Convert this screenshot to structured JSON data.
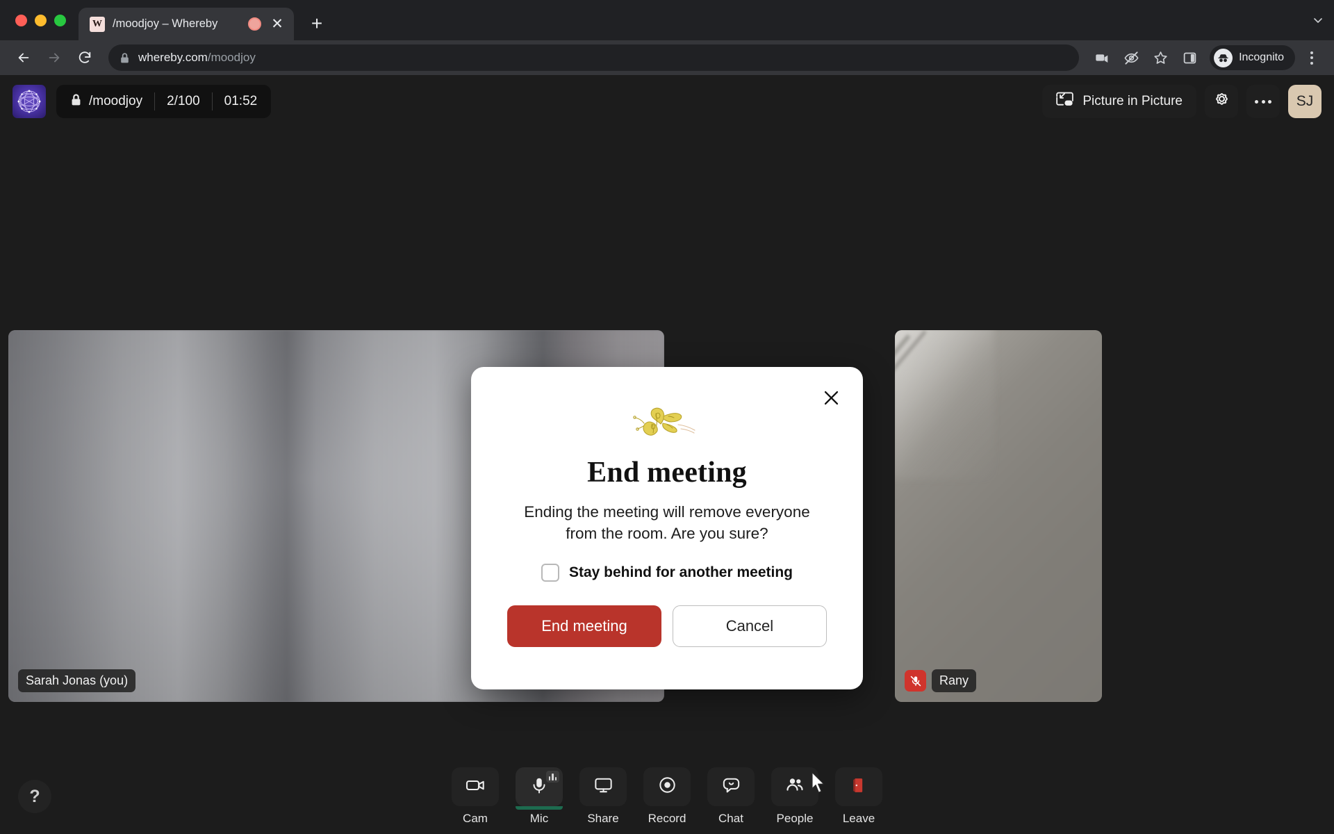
{
  "browser": {
    "tab": {
      "favicon_letter": "W",
      "title": "/moodjoy – Whereby",
      "media_indicator_icon": "recording-indicator-icon",
      "close_icon": "✕"
    },
    "new_tab_icon": "+",
    "tabstrip_chevron_icon": "⌄",
    "nav": {
      "back_icon": "back-arrow-icon",
      "forward_icon": "forward-arrow-icon",
      "reload_icon": "reload-icon"
    },
    "omnibox": {
      "lock_icon": "lock-icon",
      "url_domain": "whereby.com",
      "url_path": "/moodjoy"
    },
    "toolbar_icons": [
      "camera-icon",
      "eye-off-icon",
      "star-icon",
      "side-panel-icon"
    ],
    "profile": {
      "label": "Incognito",
      "avatar_icon": "incognito-hat-icon"
    },
    "menu_icon": "three-dot-menu-icon"
  },
  "app_header": {
    "logo_icon": "whereby-room-logo",
    "room": {
      "lock_icon": "lock-icon",
      "room_name": "/moodjoy",
      "participants": "2/100",
      "elapsed": "01:52"
    },
    "pip": {
      "icon": "picture-in-picture-icon",
      "label": "Picture in Picture"
    },
    "settings_icon": "gear-icon",
    "more_icon": "three-dot-menu-icon",
    "avatar_initials": "SJ"
  },
  "tiles": [
    {
      "name": "Sarah Jonas (you)",
      "muted": false,
      "mute_icon": "mic-off-icon"
    },
    {
      "name": "Rany",
      "muted": true,
      "mute_icon": "mic-off-icon"
    }
  ],
  "bottom_toolbar": [
    {
      "label": "Cam",
      "icon": "camera-icon",
      "active": false
    },
    {
      "label": "Mic",
      "icon": "microphone-icon",
      "active": true
    },
    {
      "label": "Share",
      "icon": "screen-share-icon",
      "active": false
    },
    {
      "label": "Record",
      "icon": "record-icon",
      "active": false
    },
    {
      "label": "Chat",
      "icon": "chat-bubble-icon",
      "active": false
    },
    {
      "label": "People",
      "icon": "people-icon",
      "active": false
    },
    {
      "label": "Leave",
      "icon": "leave-door-icon",
      "active": false
    }
  ],
  "help_button": {
    "label": "?",
    "icon": "question-mark-icon"
  },
  "modal": {
    "illustration_icon": "butterfly-illustration",
    "close_icon": "close-x-icon",
    "title": "End meeting",
    "body": "Ending the meeting will remove everyone from the room. Are you sure?",
    "checkbox_label": "Stay behind for another meeting",
    "checkbox_checked": false,
    "confirm_label": "End meeting",
    "cancel_label": "Cancel"
  },
  "colors": {
    "danger": "#b9342b",
    "leave_icon": "#c8382f",
    "mic_active_underline": "#1d6b4f",
    "avatar_bg": "#d9c8b0",
    "app_bg": "#1c1c1c",
    "modal_bg": "#ffffff",
    "butterfly": "#e3cf52"
  },
  "cursor": {
    "icon": "arrow-cursor"
  }
}
